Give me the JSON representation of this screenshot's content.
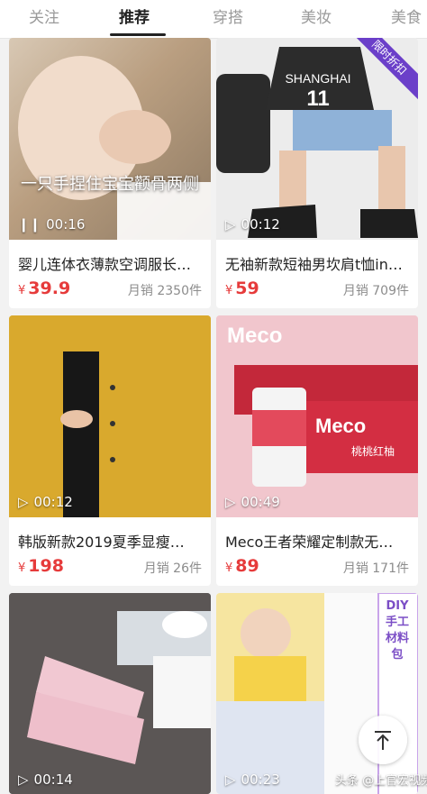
{
  "tabs": {
    "items": [
      {
        "label": "关注"
      },
      {
        "label": "推荐"
      },
      {
        "label": "穿搭"
      },
      {
        "label": "美妆"
      },
      {
        "label": "美食"
      }
    ],
    "active": "推荐"
  },
  "products": [
    {
      "title": "婴儿连体衣薄款空调服长…",
      "price": "39.9",
      "sales": "月销 2350件",
      "duration": "00:16",
      "caption": "一只手捏住宝宝颧骨两侧"
    },
    {
      "title": "无袖新款短袖男坎肩t恤in…",
      "price": "59",
      "sales": "月销 709件",
      "duration": "00:12",
      "badge": "限时折扣",
      "jersey": "SHANGHAI",
      "jersey_number": "11"
    },
    {
      "title": "韩版新款2019夏季显瘦…",
      "price": "198",
      "sales": "月销 26件",
      "duration": "00:12"
    },
    {
      "title": "Meco王者荣耀定制款无…",
      "price": "89",
      "sales": "月销 171件",
      "duration": "00:49",
      "brand": "Meco",
      "flavor": "桃桃红柚"
    },
    {
      "title": "",
      "price": "",
      "sales": "",
      "duration": "00:14"
    },
    {
      "title": "",
      "price": "",
      "sales": "",
      "duration": "00:23",
      "side_label": "DIY 手工材料包"
    }
  ],
  "currency": "¥",
  "watermark": "头条 @上官宏视频",
  "colors": {
    "price": "#e63b3b",
    "accent": "#222222",
    "badge": "#6b3fc9"
  }
}
